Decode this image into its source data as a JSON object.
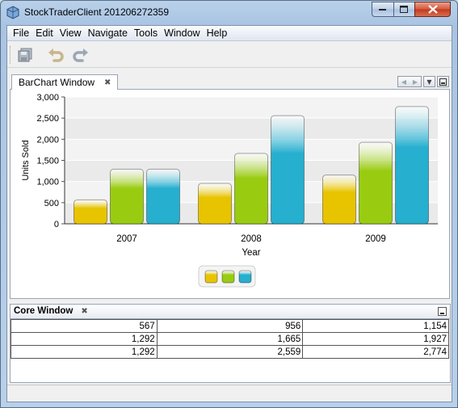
{
  "window": {
    "title": "StockTraderClient 201206272359"
  },
  "menu": [
    "File",
    "Edit",
    "View",
    "Navigate",
    "Tools",
    "Window",
    "Help"
  ],
  "toolbar": {
    "icons": [
      "save-all-icon",
      "undo-icon",
      "redo-icon"
    ]
  },
  "chart_window": {
    "tab_label": "BarChart Window"
  },
  "chart_data": {
    "type": "bar",
    "categories": [
      "2007",
      "2008",
      "2009"
    ],
    "series": [
      {
        "values": [
          567,
          956,
          1154
        ],
        "color": "#e8c400"
      },
      {
        "values": [
          1292,
          1665,
          1927
        ],
        "color": "#99cc11"
      },
      {
        "values": [
          1292,
          2559,
          2774
        ],
        "color": "#26afcf"
      }
    ],
    "xlabel": "Year",
    "ylabel": "Units Sold",
    "ylim": [
      0,
      3000
    ],
    "yticks": [
      "0",
      "500",
      "1,000",
      "1,500",
      "2,000",
      "2,500",
      "3,000"
    ],
    "grid": true,
    "legend": "bottom-center"
  },
  "core_window": {
    "title": "Core Window",
    "rows": [
      [
        "567",
        "956",
        "1,154"
      ],
      [
        "1,292",
        "1,665",
        "1,927"
      ],
      [
        "1,292",
        "2,559",
        "2,774"
      ]
    ]
  },
  "colors": {
    "series1": "#e8c400",
    "series2": "#99cc11",
    "series3": "#26afcf"
  }
}
